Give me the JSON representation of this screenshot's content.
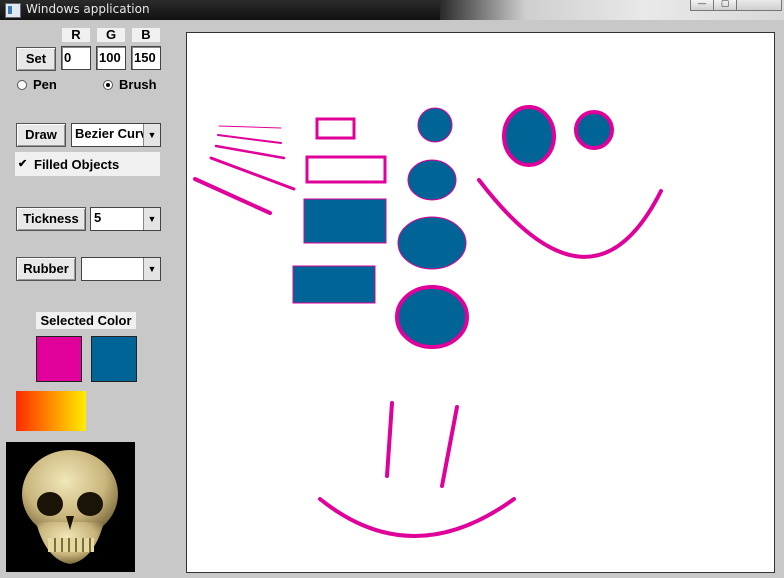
{
  "window": {
    "title": "Windows application",
    "min_glyph": "—",
    "max_glyph": "▢"
  },
  "rgb": {
    "r_label": "R",
    "g_label": "G",
    "b_label": "B",
    "r_value": "0",
    "g_value": "100",
    "b_value": "150",
    "set_label": "Set"
  },
  "mode": {
    "pen_label": "Pen",
    "brush_label": "Brush",
    "selected": "Brush"
  },
  "draw": {
    "button_label": "Draw",
    "shape_selected": "Bezier Curve",
    "arrow": "▼"
  },
  "filled": {
    "label": "Filled Objects",
    "checked": "✔"
  },
  "thickness": {
    "button_label": "Tickness",
    "value": "5",
    "arrow": "▼"
  },
  "rubber": {
    "button_label": "Rubber",
    "value": "",
    "arrow": "▼"
  },
  "selected_color": {
    "label": "Selected Color",
    "pen_color": "#e0009a",
    "brush_color": "#006496"
  },
  "gradient": {
    "from": "#ff2a00",
    "to": "#ffee00"
  },
  "skull_image": {
    "icon": "skull-icon"
  },
  "colors": {
    "pen": "#e0009a",
    "fill": "#006496",
    "canvas": "#ffffff"
  }
}
